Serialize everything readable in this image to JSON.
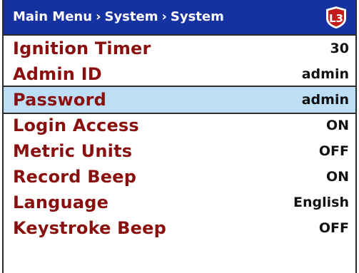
{
  "header": {
    "breadcrumb": [
      "Main Menu",
      "System",
      "System"
    ],
    "separator": "›",
    "logo_icon": "l3-logo-icon",
    "logo_text": "L3",
    "background_color": "#1631a0",
    "logo_color": "#c41a1a"
  },
  "menu": {
    "selected_index": 2,
    "selected_color": "#bddff5",
    "label_color": "#8a0f0f",
    "items": [
      {
        "label": "Ignition Timer",
        "value": "30"
      },
      {
        "label": "Admin ID",
        "value": "admin"
      },
      {
        "label": "Password",
        "value": "admin"
      },
      {
        "label": "Login Access",
        "value": "ON"
      },
      {
        "label": "Metric Units",
        "value": "OFF"
      },
      {
        "label": "Record Beep",
        "value": "ON"
      },
      {
        "label": "Language",
        "value": "English"
      },
      {
        "label": "Keystroke Beep",
        "value": "OFF"
      }
    ]
  }
}
